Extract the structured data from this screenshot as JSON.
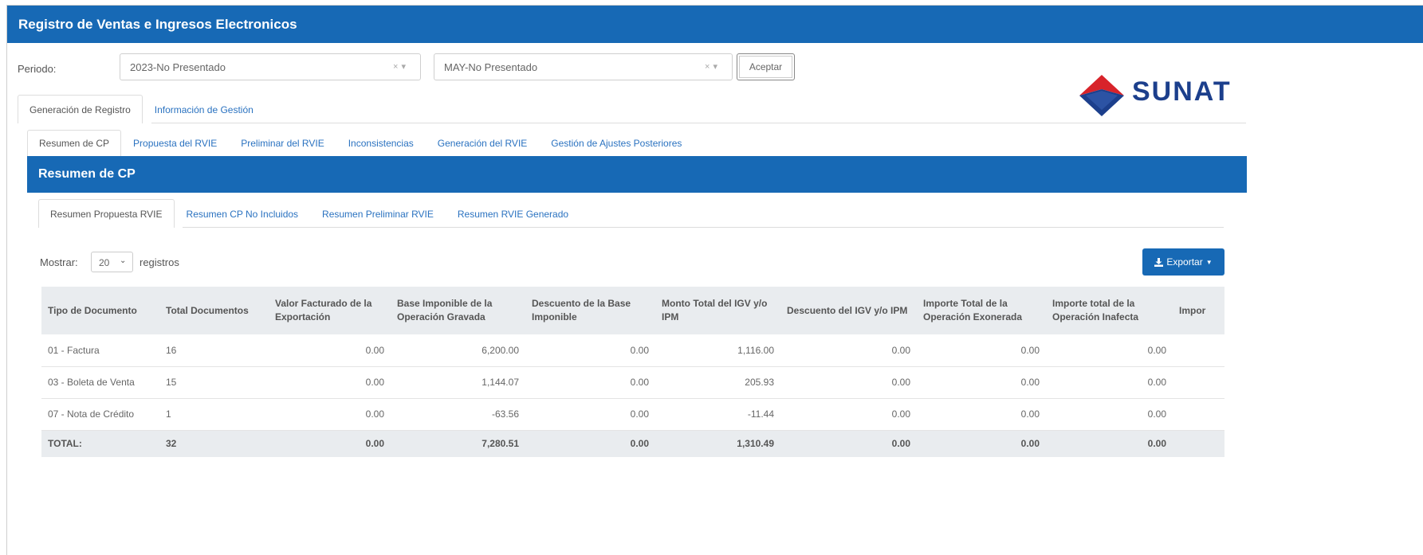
{
  "app": {
    "title": "Registro de Ventas e Ingresos Electronicos",
    "brand": "SUNAT"
  },
  "period": {
    "label": "Periodo:",
    "year_value": "2023-No Presentado",
    "month_value": "MAY-No Presentado",
    "clear_glyph": "×",
    "dropdown_glyph": "▾",
    "accept_label": "Aceptar"
  },
  "main_tabs": [
    {
      "label": "Generación de Registro",
      "active": true
    },
    {
      "label": "Información de Gestión",
      "active": false
    }
  ],
  "sub_tabs": [
    {
      "label": "Resumen de CP",
      "active": true
    },
    {
      "label": "Propuesta del RVIE",
      "active": false
    },
    {
      "label": "Preliminar del RVIE",
      "active": false
    },
    {
      "label": "Inconsistencias",
      "active": false
    },
    {
      "label": "Generación del RVIE",
      "active": false
    },
    {
      "label": "Gestión de Ajustes Posteriores",
      "active": false
    }
  ],
  "section": {
    "title": "Resumen de CP"
  },
  "inner_tabs": [
    {
      "label": "Resumen Propuesta RVIE",
      "active": true
    },
    {
      "label": "Resumen CP No Incluidos",
      "active": false
    },
    {
      "label": "Resumen Preliminar RVIE",
      "active": false
    },
    {
      "label": "Resumen RVIE Generado",
      "active": false
    }
  ],
  "length": {
    "before": "Mostrar:",
    "value": "20",
    "after": "registros"
  },
  "export": {
    "label": "Exportar",
    "icon": "download-icon"
  },
  "colors": {
    "primary": "#1769b5",
    "link": "#2a72c0",
    "header_bg": "#e9ecef",
    "logo_red": "#d8232a",
    "logo_blue": "#1c3f8c"
  },
  "table": {
    "columns": [
      "Tipo de Documento",
      "Total Documentos",
      "Valor Facturado de la Exportación",
      "Base Imponible de la Operación Gravada",
      "Descuento de la Base Imponible",
      "Monto Total del IGV y/o IPM",
      "Descuento del IGV y/o IPM",
      "Importe Total de la Operación Exonerada",
      "Importe total de la Operación Inafecta",
      "Impor"
    ],
    "rows": [
      [
        "01 - Factura",
        "16",
        "0.00",
        "6,200.00",
        "0.00",
        "1,116.00",
        "0.00",
        "0.00",
        "0.00"
      ],
      [
        "03 - Boleta de Venta",
        "15",
        "0.00",
        "1,144.07",
        "0.00",
        "205.93",
        "0.00",
        "0.00",
        "0.00"
      ],
      [
        "07 - Nota de Crédito",
        "1",
        "0.00",
        "-63.56",
        "0.00",
        "-11.44",
        "0.00",
        "0.00",
        "0.00"
      ]
    ],
    "total": [
      "TOTAL:",
      "32",
      "0.00",
      "7,280.51",
      "0.00",
      "1,310.49",
      "0.00",
      "0.00",
      "0.00"
    ]
  }
}
